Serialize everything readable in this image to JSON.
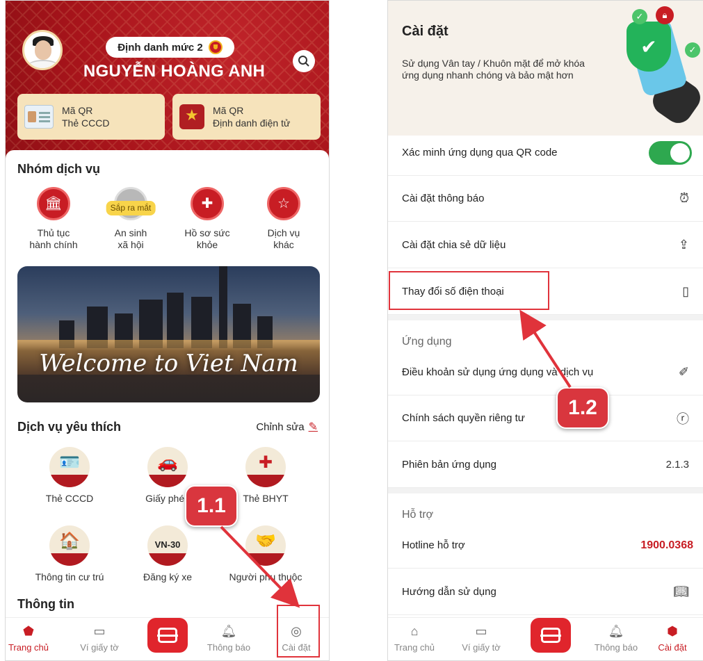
{
  "left": {
    "header": {
      "level_badge": "Định danh mức 2",
      "user_name": "NGUYỄN HOÀNG ANH",
      "qr_cards": [
        {
          "line1": "Mã QR",
          "line2": "Thẻ CCCD"
        },
        {
          "line1": "Mã QR",
          "line2": "Định danh điện tử"
        }
      ]
    },
    "service_group": {
      "title": "Nhóm dịch vụ",
      "items": [
        {
          "line1": "Thủ tục",
          "line2": "hành chính",
          "icon": "bank-icon"
        },
        {
          "line1": "An sinh",
          "line2": "xã hội",
          "icon": "social-icon",
          "badge": "Sắp ra mắt"
        },
        {
          "line1": "Hồ sơ sức",
          "line2": "khỏe",
          "icon": "health-shield-icon"
        },
        {
          "line1": "Dịch vụ",
          "line2": "khác",
          "icon": "more-services-icon"
        }
      ]
    },
    "banner": {
      "text": "Welcome to Viet Nam"
    },
    "favorites": {
      "title": "Dịch vụ yêu thích",
      "edit_label": "Chỉnh sửa",
      "items": [
        {
          "label": "Thẻ CCCD",
          "icon": "id-card-icon"
        },
        {
          "label": "Giấy phép",
          "icon": "driving-license-icon"
        },
        {
          "label": "Thẻ BHYT",
          "icon": "health-insurance-icon"
        },
        {
          "label": "Thông tin cư trú",
          "icon": "residence-icon"
        },
        {
          "label": "Đăng ký xe",
          "icon": "vehicle-plate-icon",
          "plate": "VN-30"
        },
        {
          "label": "Người phụ thuộc",
          "icon": "dependents-icon"
        }
      ]
    },
    "info_title": "Thông tin",
    "tabs": [
      {
        "label": "Trang chủ",
        "icon": "home-icon",
        "active": true
      },
      {
        "label": "Ví giấy tờ",
        "icon": "wallet-icon"
      },
      {
        "label": "",
        "icon": "scan-icon"
      },
      {
        "label": "Thông báo",
        "icon": "bell-icon"
      },
      {
        "label": "Cài đặt",
        "icon": "settings-icon"
      }
    ],
    "step_label": "1.1"
  },
  "right": {
    "header": {
      "title": "Cài đặt",
      "description": "Sử dụng Vân tay / Khuôn mặt để mở khóa ứng dụng nhanh chóng và bảo mật hơn"
    },
    "rows": [
      {
        "label": "Xác minh ứng dụng qua QR code",
        "control": "toggle-on"
      },
      {
        "label": "Cài đặt thông báo",
        "icon": "alarm-icon"
      },
      {
        "label": "Cài đặt chia sẻ dữ liệu",
        "icon": "share-icon"
      },
      {
        "label": "Thay đổi số điện thoại",
        "icon": "phone-icon"
      }
    ],
    "app_group": {
      "title": "Ứng dụng",
      "rows": [
        {
          "label": "Điều khoản sử dụng ứng dụng và dịch vụ",
          "icon": "ruler-icon"
        },
        {
          "label": "Chính sách quyền riêng tư",
          "icon": "privacy-icon"
        },
        {
          "label": "Phiên bản ứng dụng",
          "value": "2.1.3"
        }
      ]
    },
    "support_group": {
      "title": "Hỗ trợ",
      "rows": [
        {
          "label": "Hotline hỗ trợ",
          "value": "1900.0368"
        },
        {
          "label": "Hướng dẫn sử dụng",
          "icon": "book-icon"
        }
      ]
    },
    "tabs": [
      {
        "label": "Trang chủ",
        "icon": "home-icon"
      },
      {
        "label": "Ví giấy tờ",
        "icon": "wallet-icon"
      },
      {
        "label": "",
        "icon": "scan-icon"
      },
      {
        "label": "Thông báo",
        "icon": "bell-icon"
      },
      {
        "label": "Cài đặt",
        "icon": "settings-icon",
        "active": true
      }
    ],
    "step_label": "1.2"
  },
  "colors": {
    "brand_red": "#c81d24",
    "toggle_green": "#2ea84f",
    "annotation_red": "#e0333b"
  }
}
